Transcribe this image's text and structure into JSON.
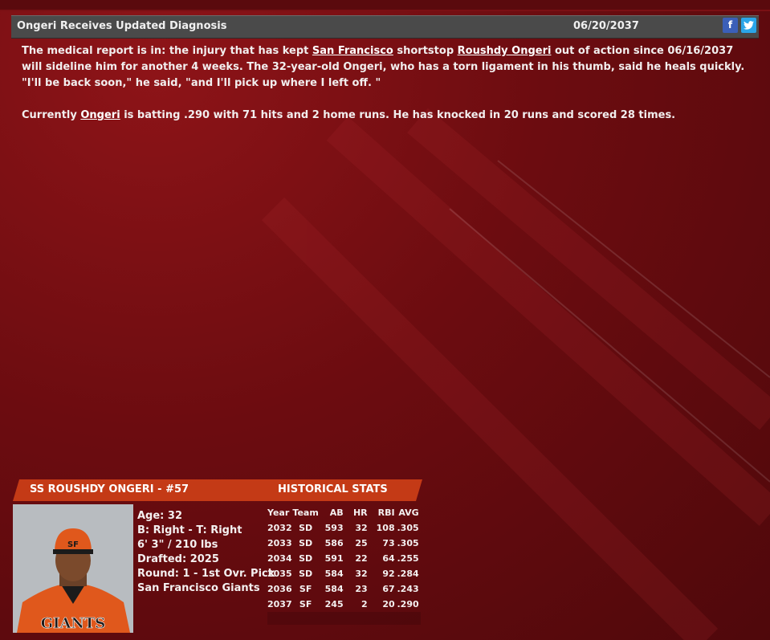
{
  "news": {
    "headline": "Ongeri Receives Updated Diagnosis",
    "date": "06/20/2037",
    "social": {
      "facebook_glyph": "f",
      "twitter_glyph": "🐦"
    },
    "p1": {
      "t1": "The medical report is in: the injury that has kept ",
      "team_link": "San Francisco",
      "t2": " shortstop ",
      "player_link": "Roushdy Ongeri",
      "t3": " out of action since 06/16/2037 will sideline him for another 4 weeks. The 32-year-old Ongeri, who has a torn ligament in his thumb, said he heals quickly. \"I'll be back soon,\" he said, \"and I'll pick up where I left off. \""
    },
    "p2": {
      "t1": "Currently ",
      "player_link": "Ongeri",
      "t2": " is batting .290 with 71 hits and 2 home runs. He has knocked in 20 runs and scored 28 times."
    }
  },
  "player": {
    "banner": "SS ROUSHDY ONGERI - #57",
    "age": "Age: 32",
    "bats_throws": "B: Right - T: Right",
    "size": "6' 3\" / 210 lbs",
    "drafted": "Drafted: 2025",
    "round": "Round: 1 - 1st Ovr. Pick",
    "team": "San Francisco Giants",
    "jersey_text": "GIANTS",
    "cap_logo": "SF"
  },
  "stats": {
    "title": "HISTORICAL STATS",
    "headers": [
      "Year",
      "Team",
      "AB",
      "HR",
      "RBI",
      "AVG"
    ],
    "rows": [
      [
        "2032",
        "SD",
        "593",
        "32",
        "108",
        ".305"
      ],
      [
        "2033",
        "SD",
        "586",
        "25",
        "73",
        ".305"
      ],
      [
        "2034",
        "SD",
        "591",
        "22",
        "64",
        ".255"
      ],
      [
        "2035",
        "SD",
        "584",
        "32",
        "92",
        ".284"
      ],
      [
        "2036",
        "SF",
        "584",
        "23",
        "67",
        ".243"
      ],
      [
        "2037",
        "SF",
        "245",
        "2",
        "20",
        ".290"
      ]
    ]
  },
  "colors": {
    "background": "#6c0c10",
    "header_bar": "#4a4a4a",
    "banner": "#c43a16",
    "facebook": "#3b5fb8",
    "twitter": "#2aa5e8"
  }
}
